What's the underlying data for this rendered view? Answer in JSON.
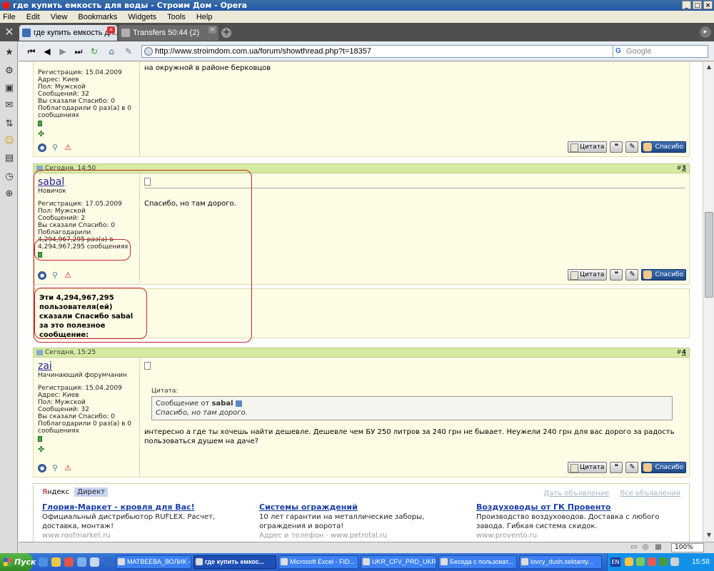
{
  "window": {
    "title": "где купить емкость для воды - Строим Дом - Opera",
    "min": "_",
    "max": "□",
    "close": "×"
  },
  "menu": [
    "File",
    "Edit",
    "View",
    "Bookmarks",
    "Widgets",
    "Tools",
    "Help"
  ],
  "tabs": [
    {
      "label": "где купить емкость дл...",
      "close": "×"
    },
    {
      "label": "Transfers 50:44 (2)",
      "close": "×"
    }
  ],
  "newtab_label": "+",
  "nav": {
    "address": "http://www.stroimdom.com.ua/forum/showthread.php?t=18357",
    "search_placeholder": "Google",
    "search_logo": "G"
  },
  "post_top": {
    "stats": [
      "Регистрация: 15.04.2009",
      "Адрес: Киев",
      "Пол: Мужской",
      "Сообщений: 32",
      "Вы сказали Спасибо: 0",
      "Поблагодарили 0 раз(а) в 0 сообщениях"
    ],
    "text": "на окружной в районе берковцов"
  },
  "post3": {
    "date": "Сегодня, 14:50",
    "num_prefix": "#",
    "num": "3",
    "username": "sabal",
    "rank": "Новичок",
    "stats": [
      "Регистрация: 17.05.2009",
      "Пол: Мужской",
      "Сообщений: 2",
      "Вы сказали Спасибо: 0",
      "Поблагодарили"
    ],
    "thanks_stat": [
      "4,294,967,295 раз(а) в",
      "4,294,967,295 сообщениях"
    ],
    "text": "Спасибо, но там дорого.",
    "thanks_msg": "Эти 4,294,967,295 пользователя(ей) сказали Спасибо sabal за это полезное сообщение:"
  },
  "post4": {
    "date": "Сегодня, 15:25",
    "num_prefix": "#",
    "num": "4",
    "username": "zai",
    "rank": "Начинающий форумчанин",
    "stats": [
      "Регистрация: 15.04.2009",
      "Адрес: Киев",
      "Пол: Мужской",
      "Сообщений: 32",
      "Вы сказали Спасибо: 0",
      "Поблагодарили 0 раз(а) в 0 сообщениях"
    ],
    "quote_label": "Цитата:",
    "quote_from_prefix": "Сообщение от",
    "quote_author": "sabal",
    "quote_text": "Спасибо, но там дорого.",
    "text": "интересно а где ты хочешь найти дешевле. Дешевле чем БУ 250 литров за 240 грн не бывает. Неужели 240 грн для вас дорого за радость пользоваться душем на даче?"
  },
  "buttons": {
    "quote": "Цитата",
    "thanks": "Спасибо"
  },
  "ads": {
    "yandex_y": "Я",
    "yandex_rest": "ндекс",
    "direct": "Директ",
    "link_submit": "Дать объявление",
    "link_all": "Все объявления",
    "items": [
      {
        "title": "Глория-Маркет - кровля для Вас!",
        "desc": "Официальный дистрибьютор RUFLEX. Расчет, доставка, монтаж!",
        "url": "www.roofmarket.ru"
      },
      {
        "title": "Системы ограждений",
        "desc": "10 лет гарантии на металлические заборы, ограждения и ворота!",
        "url": "Адрес и телефон · www.petrotal.ru"
      },
      {
        "title": "Воздуховоды от ГК Провенто",
        "desc": "Производство воздуховодов. Доставка с любого завода. Гибкая система скидок.",
        "url": "www.provento.ru"
      }
    ]
  },
  "status": {
    "zoom": "100%"
  },
  "taskbar": {
    "start": "Пуск",
    "tasks": [
      "МАТВЕЕВА_ВОЛИК -...",
      "где купить емкос...",
      "Microsoft Excel - FID...",
      "UKR_CFV_PRD_UKR ...",
      "Беседа с пользоват...",
      "lovcy_dush.sektanty..."
    ],
    "lang": "EN",
    "clock": "15:58"
  }
}
